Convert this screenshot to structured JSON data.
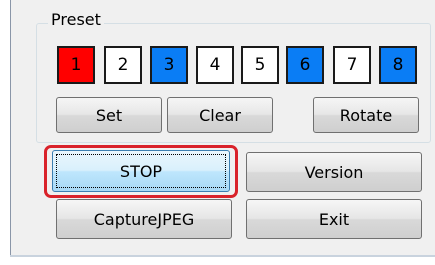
{
  "preset": {
    "title": "Preset",
    "boxes": [
      {
        "label": "1",
        "color": "#ff0000"
      },
      {
        "label": "2",
        "color": "#ffffff"
      },
      {
        "label": "3",
        "color": "#0a7df5"
      },
      {
        "label": "4",
        "color": "#ffffff"
      },
      {
        "label": "5",
        "color": "#ffffff"
      },
      {
        "label": "6",
        "color": "#0a7df5"
      },
      {
        "label": "7",
        "color": "#ffffff"
      },
      {
        "label": "8",
        "color": "#0a7df5"
      }
    ],
    "set_label": "Set",
    "clear_label": "Clear",
    "rotate_label": "Rotate"
  },
  "controls": {
    "stop_label": "STOP",
    "version_label": "Version",
    "capture_label": "CaptureJPEG",
    "exit_label": "Exit"
  },
  "colors": {
    "highlight": "#d9222a"
  }
}
